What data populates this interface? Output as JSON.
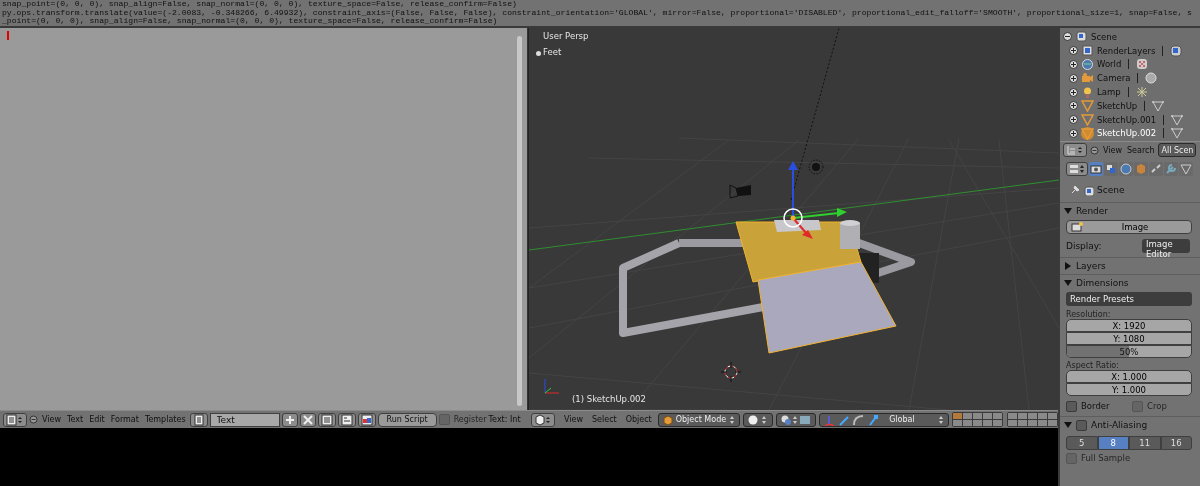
{
  "console": {
    "lines": [
      "snap_point=(0, 0, 0), snap_align=False, snap_normal=(0, 0, 0), texture_space=False, release_confirm=False)",
      "py.ops.transform.translate(value=(-2.0083, -0.348266, 6.49932), constraint_axis=(False, False, False), constraint_orientation='GLOBAL', mirror=False, proportional='DISABLED', proportional_edit_falloff='SMOOTH', proportional_size=1, snap=False, s",
      "_point=(0, 0, 0), snap_align=False, snap_normal=(0, 0, 0), texture_space=False, release_confirm=False)"
    ]
  },
  "text_editor": {
    "header": {
      "menus": [
        "View",
        "Text",
        "Edit",
        "Format",
        "Templates"
      ],
      "datablock": "Text",
      "run_button": "Run Script",
      "register": {
        "label": "Register",
        "checked": false,
        "disabled": true
      },
      "status": "Text: Int"
    }
  },
  "viewport": {
    "view_name": "User Persp",
    "units": "Feet",
    "object_label": "(1) SketchUp.002",
    "header": {
      "menus": [
        "View",
        "Select",
        "Object"
      ],
      "mode": "Object Mode",
      "orientation": "Global"
    }
  },
  "outliner": {
    "tree": [
      {
        "label": "Scene",
        "kind": "scene",
        "expanded": true,
        "selected": false,
        "children": [
          {
            "label": "RenderLayers",
            "kind": "renderlayers",
            "expanded": false,
            "selected": false
          },
          {
            "label": "World",
            "kind": "world",
            "expanded": false,
            "selected": false
          },
          {
            "label": "Camera",
            "kind": "camera",
            "expanded": false,
            "selected": false
          },
          {
            "label": "Lamp",
            "kind": "lamp",
            "expanded": false,
            "selected": false
          },
          {
            "label": "SketchUp",
            "kind": "mesh",
            "expanded": false,
            "selected": false
          },
          {
            "label": "SketchUp.001",
            "kind": "mesh",
            "expanded": false,
            "selected": false
          },
          {
            "label": "SketchUp.002",
            "kind": "mesh",
            "expanded": false,
            "selected": true
          }
        ]
      }
    ],
    "header": {
      "menus": [
        "View",
        "Search"
      ],
      "filter": "All Scen"
    }
  },
  "properties": {
    "tabs": [
      {
        "kind": "render",
        "selected": true
      },
      {
        "kind": "layers",
        "selected": false
      },
      {
        "kind": "world",
        "selected": false
      },
      {
        "kind": "object",
        "selected": false
      },
      {
        "kind": "constraints",
        "selected": false
      },
      {
        "kind": "modifiers",
        "selected": false
      },
      {
        "kind": "data",
        "selected": false
      }
    ],
    "context": "Scene",
    "panels": [
      {
        "kind": "render",
        "title": "Render",
        "expanded": true,
        "button": "Image",
        "display_label": "Display:",
        "display_value": "Image Editor"
      },
      {
        "kind": "layers",
        "title": "Layers",
        "expanded": false
      },
      {
        "kind": "dimensions",
        "title": "Dimensions",
        "expanded": true,
        "presets": "Render Presets",
        "resolution_label": "Resolution:",
        "res_x": "X: 1920",
        "res_y": "Y: 1080",
        "percent": {
          "text": "50%",
          "level": 0.5
        },
        "aspect_label": "Aspect Ratio:",
        "aspect_x": "X: 1.000",
        "aspect_y": "Y: 1.000",
        "options": [
          {
            "label": "Border",
            "checked": false,
            "disabled": false
          },
          {
            "label": "Crop",
            "checked": false,
            "disabled": true
          }
        ]
      },
      {
        "kind": "antialiasing",
        "title": "Anti-Aliasing",
        "expanded": true,
        "checked": false,
        "samples": [
          {
            "label": "5",
            "selected": false
          },
          {
            "label": "8",
            "selected": true
          },
          {
            "label": "11",
            "selected": false
          },
          {
            "label": "16",
            "selected": false
          }
        ],
        "full_sample": {
          "label": "Full Sample",
          "checked": false,
          "disabled": true
        }
      }
    ]
  }
}
